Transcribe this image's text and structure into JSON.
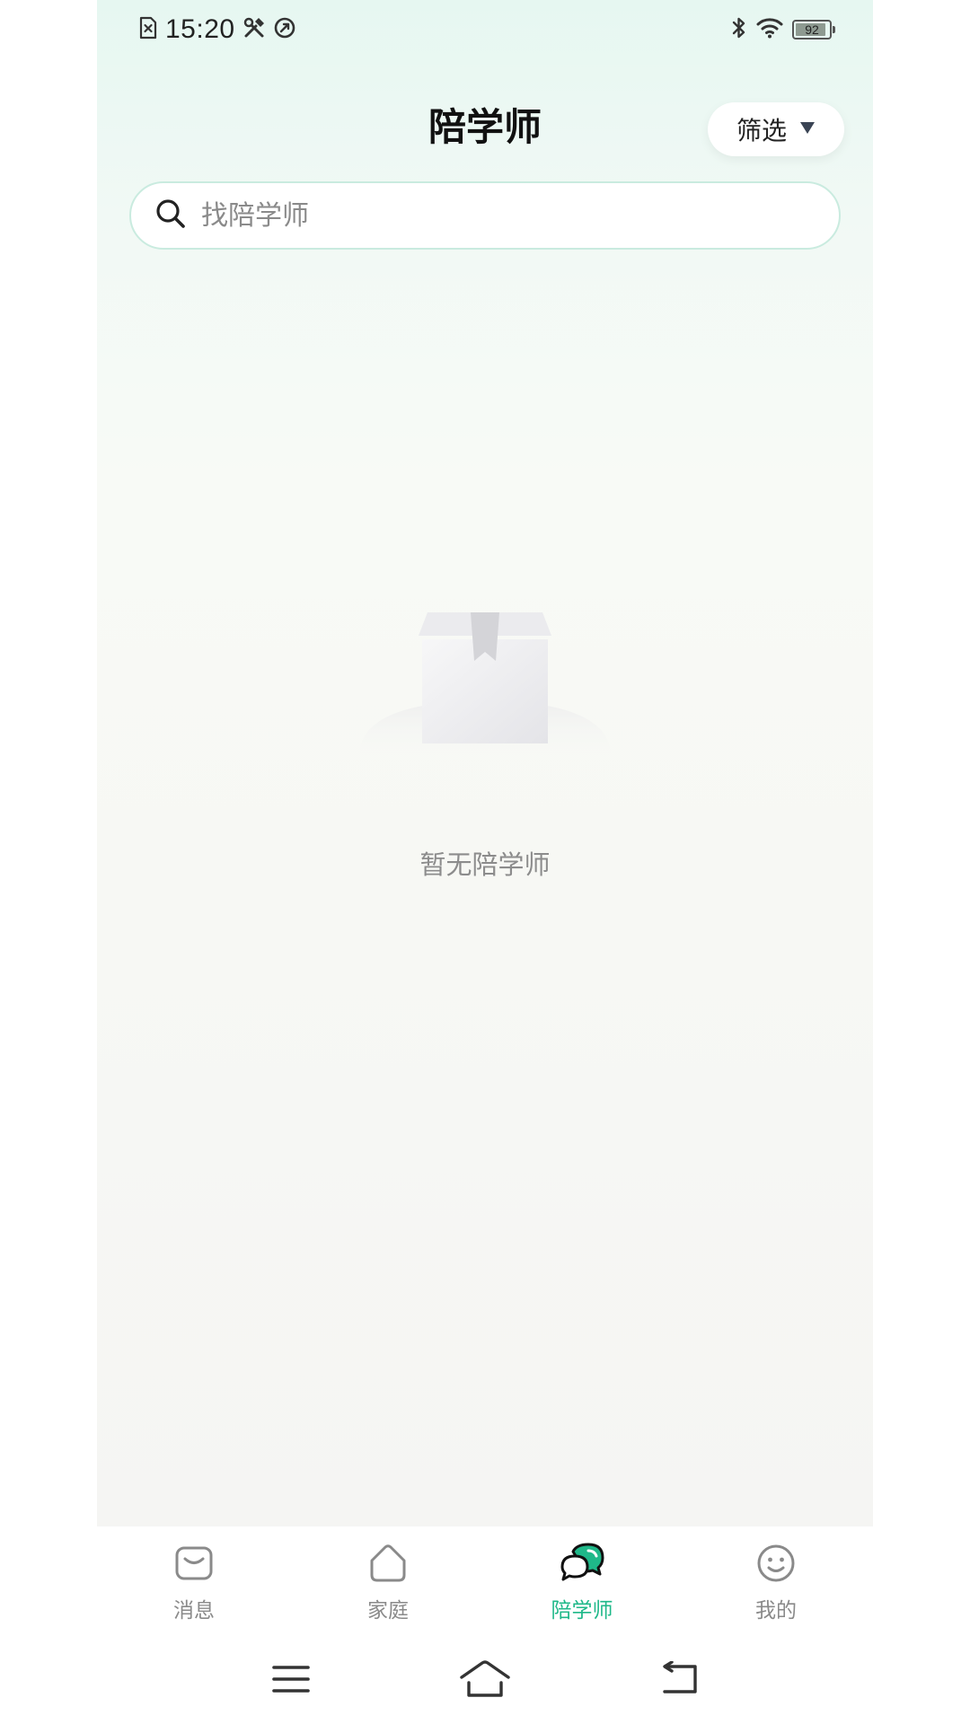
{
  "status_bar": {
    "time": "15:20",
    "battery": "92",
    "battery_level": 0.92,
    "left_icons": [
      "sim-error-icon",
      "tools-icon",
      "sync-icon"
    ],
    "right_icons": [
      "bluetooth-icon",
      "wifi-icon",
      "battery-icon"
    ]
  },
  "header": {
    "title": "陪学师",
    "filter_label": "筛选"
  },
  "search": {
    "placeholder": "找陪学师",
    "value": ""
  },
  "empty_state": {
    "text": "暂无陪学师",
    "icon": "empty-box-icon"
  },
  "tab_bar": {
    "active_color": "#1fb889",
    "inactive_color": "#8a8a8a",
    "items": [
      {
        "label": "消息",
        "icon": "message-icon",
        "active": false
      },
      {
        "label": "家庭",
        "icon": "home-icon",
        "active": false
      },
      {
        "label": "陪学师",
        "icon": "chat-bubbles-icon",
        "active": true
      },
      {
        "label": "我的",
        "icon": "smiley-icon",
        "active": false
      }
    ]
  },
  "system_nav": {
    "icons": [
      "menu-icon",
      "home-nav-icon",
      "back-icon"
    ]
  }
}
